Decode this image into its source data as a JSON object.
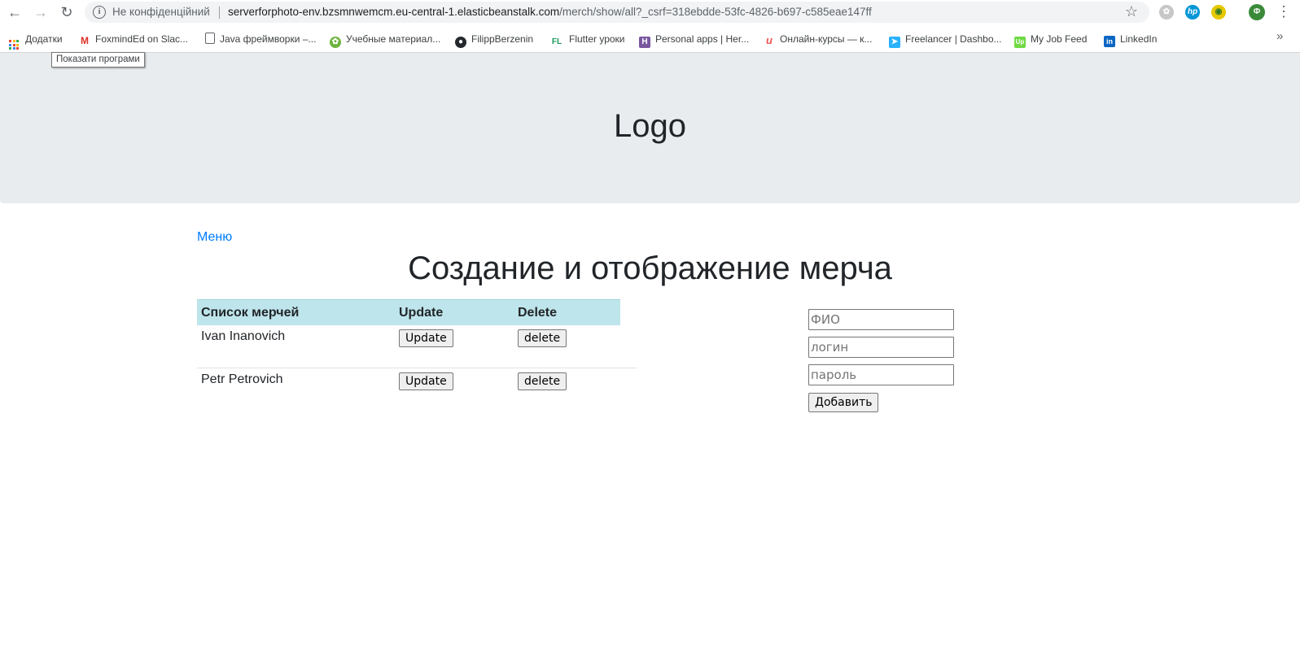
{
  "browser": {
    "security_label": "Не конфіденційний",
    "url_domain": "serverforphoto-env.bzsmnwemcm.eu-central-1.elasticbeanstalk.com",
    "url_path": "/merch/show/all?_csrf=318ebdde-53fc-4826-b697-c585eae147ff",
    "profile_initial": "Ф",
    "bookmarks": [
      {
        "label": "Додатки",
        "icon": "apps-grid-icon"
      },
      {
        "label": "FoxmindEd on Slac...",
        "icon": "gmail-icon"
      },
      {
        "label": "Java фреймворки –...",
        "icon": "page-icon"
      },
      {
        "label": "Учебные материал...",
        "icon": "spring-icon"
      },
      {
        "label": "FilippBerzenin",
        "icon": "github-icon"
      },
      {
        "label": "Flutter уроки",
        "icon": "fl-icon"
      },
      {
        "label": "Personal apps | Her...",
        "icon": "heroku-icon"
      },
      {
        "label": "Онлайн-курсы — к...",
        "icon": "udemy-icon"
      },
      {
        "label": "Freelancer | Dashbo...",
        "icon": "freelancer-icon"
      },
      {
        "label": "My Job Feed",
        "icon": "upwork-icon"
      },
      {
        "label": "LinkedIn",
        "icon": "linkedin-icon"
      }
    ],
    "tooltip": "Показати програми"
  },
  "page": {
    "logo": "Logo",
    "menu_link": "Меню",
    "title": "Создание и отображение мерча",
    "table": {
      "headers": [
        "Список мерчей",
        "Update",
        "Delete"
      ],
      "rows": [
        {
          "name": "Ivan Inanovich",
          "update_label": "Update",
          "delete_label": "delete"
        },
        {
          "name": "Petr Petrovich",
          "update_label": "Update",
          "delete_label": "delete"
        }
      ]
    },
    "form": {
      "fio_placeholder": "ФИО",
      "login_placeholder": "логин",
      "password_placeholder": "пароль",
      "submit_label": "Добавить"
    }
  },
  "colors": {
    "link": "#007bff",
    "table_header": "#bee5eb",
    "banner": "#e9ecef"
  }
}
